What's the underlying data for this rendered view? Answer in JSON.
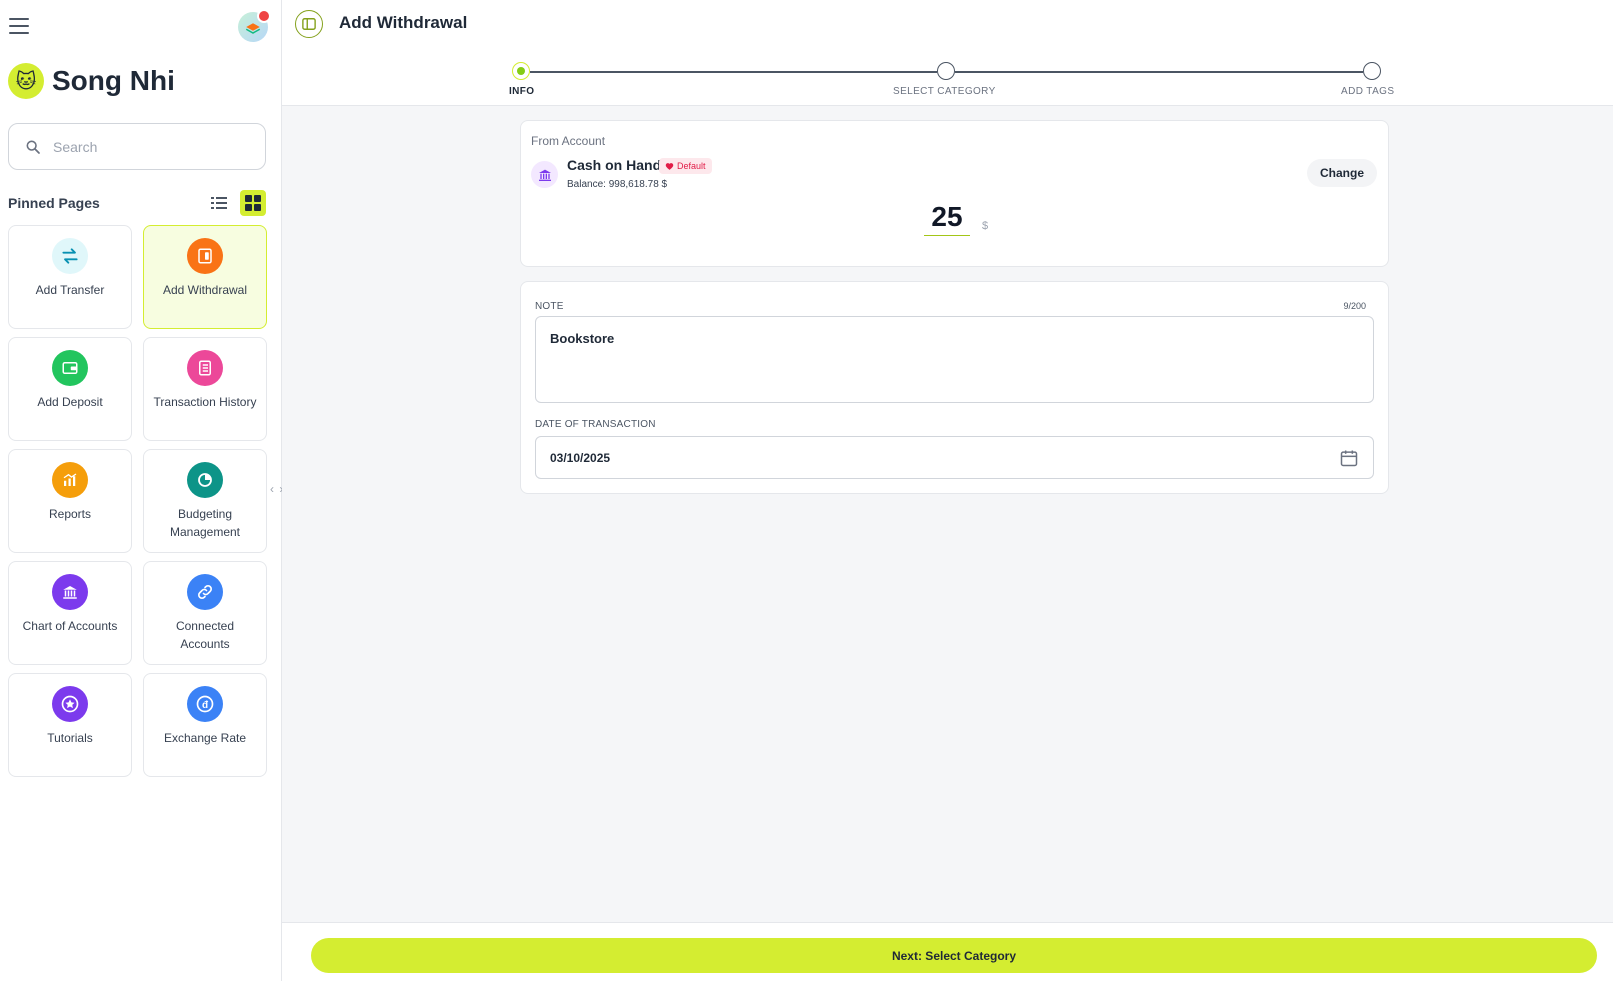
{
  "user": {
    "name": "Song Nhi",
    "avatar_emoji": "🐱"
  },
  "search": {
    "placeholder": "Search",
    "value": ""
  },
  "pinned": {
    "title": "Pinned Pages",
    "view_modes": [
      "list",
      "grid"
    ],
    "active_view": "grid",
    "tiles": [
      {
        "label": "Add Transfer",
        "icon": "transfer-icon",
        "icon_bg": "#e0f7fa",
        "icon_color": "#0891b2",
        "active": false
      },
      {
        "label": "Add Withdrawal",
        "icon": "withdrawal-icon",
        "icon_bg": "#f97316",
        "icon_color": "#ffffff",
        "active": true
      },
      {
        "label": "Add Deposit",
        "icon": "wallet-icon",
        "icon_bg": "#22c55e",
        "icon_color": "#ffffff",
        "active": false
      },
      {
        "label": "Transaction History",
        "icon": "ledger-icon",
        "icon_bg": "#ec4899",
        "icon_color": "#ffffff",
        "active": false
      },
      {
        "label": "Reports",
        "icon": "chart-icon",
        "icon_bg": "#f59e0b",
        "icon_color": "#ffffff",
        "active": false
      },
      {
        "label": "Budgeting Management",
        "icon": "pie-chart-icon",
        "icon_bg": "#0d9488",
        "icon_color": "#ffffff",
        "active": false
      },
      {
        "label": "Chart of Accounts",
        "icon": "bank-icon",
        "icon_bg": "#7c3aed",
        "icon_color": "#ffffff",
        "active": false
      },
      {
        "label": "Connected Accounts",
        "icon": "link-icon",
        "icon_bg": "#3b82f6",
        "icon_color": "#ffffff",
        "active": false
      },
      {
        "label": "Tutorials",
        "icon": "star-icon",
        "icon_bg": "#7c3aed",
        "icon_color": "#ffffff",
        "active": false
      },
      {
        "label": "Exchange Rate",
        "icon": "currency-icon",
        "icon_bg": "#3b82f6",
        "icon_color": "#ffffff",
        "active": false
      }
    ]
  },
  "header": {
    "title": "Add Withdrawal"
  },
  "stepper": {
    "steps": [
      {
        "label": "INFO",
        "active": true
      },
      {
        "label": "SELECT CATEGORY",
        "active": false
      },
      {
        "label": "ADD TAGS",
        "active": false
      }
    ]
  },
  "account": {
    "section_label": "From Account",
    "name": "Cash on Hand",
    "badge": "Default",
    "balance_label": "Balance:",
    "balance_value": "998,618.78 $",
    "change_label": "Change"
  },
  "amount": {
    "value": "25",
    "currency": "$"
  },
  "note": {
    "label": "NOTE",
    "value": "Bookstore",
    "counter": "9/200"
  },
  "date": {
    "label": "DATE OF TRANSACTION",
    "value": "03/10/2025"
  },
  "footer": {
    "next_label": "Next: Select Category"
  },
  "colors": {
    "accent": "#d4ed31",
    "accent_dark": "#84a11c",
    "background": "#f5f6f8"
  }
}
